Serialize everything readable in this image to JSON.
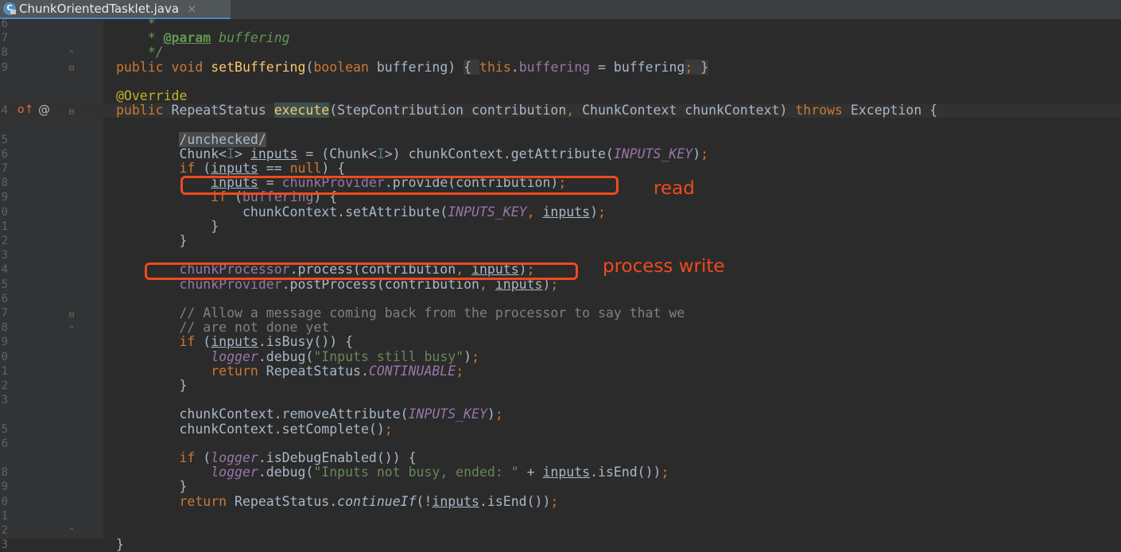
{
  "tab": {
    "filename": "ChunkOrientedTasklet.java",
    "close": "×",
    "icon": "C"
  },
  "gutter": {
    "line_numbers": [
      "6",
      "7",
      "8",
      "9",
      "",
      "",
      "4",
      "",
      "5",
      "6",
      "7",
      "8",
      "9",
      "0",
      "1",
      "2",
      "3",
      "4",
      "5",
      "6",
      "7",
      "8",
      "9",
      "0",
      "1",
      "2",
      "3",
      "",
      "5",
      "6",
      "",
      "8",
      "9",
      "0",
      "1",
      "2",
      "3"
    ],
    "override_icon": "o↑",
    "at_icon": "@"
  },
  "lines": [
    {
      "ln": "6",
      "segs": [
        {
          "t": "    *",
          "c": "doc"
        }
      ]
    },
    {
      "ln": "7",
      "segs": [
        {
          "t": "    * ",
          "c": "doc"
        },
        {
          "t": "@param",
          "c": "doctag"
        },
        {
          "t": " buffering",
          "c": "doc"
        }
      ]
    },
    {
      "ln": "8",
      "segs": [
        {
          "t": "    */",
          "c": "doc"
        }
      ]
    },
    {
      "ln": "9",
      "segs": [
        {
          "t": "public ",
          "c": "kw"
        },
        {
          "t": "void ",
          "c": "kw"
        },
        {
          "t": "setBuffering",
          "c": "mth"
        },
        {
          "t": "("
        },
        {
          "t": "boolean ",
          "c": "kw"
        },
        {
          "t": "buffering) "
        },
        {
          "t": "{ ",
          "c": "fold-bg"
        },
        {
          "t": "this",
          "c": "kw"
        },
        {
          "t": "."
        },
        {
          "t": "buffering",
          "c": "fld"
        },
        {
          "t": " = buffering"
        },
        {
          "t": "; ",
          "c": "kw fold-bg"
        },
        {
          "t": "}",
          "c": "fold-bg"
        }
      ]
    },
    {
      "ln": "",
      "segs": []
    },
    {
      "ln": "",
      "segs": [
        {
          "t": "@Override",
          "c": "ann"
        }
      ]
    },
    {
      "ln": "4",
      "segs": [
        {
          "t": "public ",
          "c": "kw"
        },
        {
          "t": "RepeatStatus "
        },
        {
          "t": "execute",
          "c": "mth hl"
        },
        {
          "t": "(StepContribution contribution"
        },
        {
          "t": ", ",
          "c": "kw"
        },
        {
          "t": "ChunkContext chunkContext) "
        },
        {
          "t": "throws ",
          "c": "kw"
        },
        {
          "t": "Exception {"
        }
      ]
    },
    {
      "ln": "",
      "segs": []
    },
    {
      "ln": "5",
      "segs": [
        {
          "t": "        "
        },
        {
          "t": "/unchecked/",
          "c": "unch"
        }
      ]
    },
    {
      "ln": "6",
      "segs": [
        {
          "t": "        Chunk<"
        },
        {
          "t": "I",
          "c": "tp"
        },
        {
          "t": "> "
        },
        {
          "t": "inputs",
          "c": "ul"
        },
        {
          "t": " = (Chunk<"
        },
        {
          "t": "I",
          "c": "tp"
        },
        {
          "t": ">) chunkContext.getAttribute("
        },
        {
          "t": "INPUTS_KEY",
          "c": "sfi"
        },
        {
          "t": ")"
        },
        {
          "t": ";",
          "c": "kw"
        }
      ]
    },
    {
      "ln": "7",
      "segs": [
        {
          "t": "        "
        },
        {
          "t": "if ",
          "c": "kw"
        },
        {
          "t": "("
        },
        {
          "t": "inputs",
          "c": "ul"
        },
        {
          "t": " == "
        },
        {
          "t": "null",
          "c": "kw"
        },
        {
          "t": ") {"
        }
      ]
    },
    {
      "ln": "8",
      "segs": [
        {
          "t": "            "
        },
        {
          "t": "inputs",
          "c": "ul"
        },
        {
          "t": " = "
        },
        {
          "t": "chunkProvider",
          "c": "fld"
        },
        {
          "t": ".provide(contribution)"
        },
        {
          "t": ";",
          "c": "kw"
        }
      ]
    },
    {
      "ln": "9",
      "segs": [
        {
          "t": "            "
        },
        {
          "t": "if ",
          "c": "kw"
        },
        {
          "t": "("
        },
        {
          "t": "buffering",
          "c": "fld"
        },
        {
          "t": ") {"
        }
      ]
    },
    {
      "ln": "0",
      "segs": [
        {
          "t": "                chunkContext.setAttribute("
        },
        {
          "t": "INPUTS_KEY",
          "c": "sfi"
        },
        {
          "t": ", ",
          "c": "kw"
        },
        {
          "t": "inputs",
          "c": "ul"
        },
        {
          "t": ")"
        },
        {
          "t": ";",
          "c": "kw"
        }
      ]
    },
    {
      "ln": "1",
      "segs": [
        {
          "t": "            }"
        }
      ]
    },
    {
      "ln": "2",
      "segs": [
        {
          "t": "        }"
        }
      ]
    },
    {
      "ln": "3",
      "segs": []
    },
    {
      "ln": "4",
      "segs": [
        {
          "t": "        "
        },
        {
          "t": "chunkProcessor",
          "c": "fld"
        },
        {
          "t": ".process(contribution"
        },
        {
          "t": ", ",
          "c": "kw"
        },
        {
          "t": "inputs",
          "c": "ul"
        },
        {
          "t": ")"
        },
        {
          "t": ";",
          "c": "kw"
        }
      ]
    },
    {
      "ln": "5",
      "segs": [
        {
          "t": "        "
        },
        {
          "t": "chunkProvider",
          "c": "fld"
        },
        {
          "t": ".postProcess(contribution"
        },
        {
          "t": ", ",
          "c": "kw"
        },
        {
          "t": "inputs",
          "c": "ul"
        },
        {
          "t": ")"
        },
        {
          "t": ";",
          "c": "kw"
        }
      ]
    },
    {
      "ln": "6",
      "segs": []
    },
    {
      "ln": "7",
      "segs": [
        {
          "t": "        // Allow a message coming back from the processor to say that we",
          "c": "cm"
        }
      ]
    },
    {
      "ln": "8",
      "segs": [
        {
          "t": "        // are not done yet",
          "c": "cm"
        }
      ]
    },
    {
      "ln": "9",
      "segs": [
        {
          "t": "        "
        },
        {
          "t": "if ",
          "c": "kw"
        },
        {
          "t": "("
        },
        {
          "t": "inputs",
          "c": "ul"
        },
        {
          "t": ".isBusy()) {"
        }
      ]
    },
    {
      "ln": "0",
      "segs": [
        {
          "t": "            "
        },
        {
          "t": "logger",
          "c": "sfi"
        },
        {
          "t": ".debug("
        },
        {
          "t": "\"Inputs still busy\"",
          "c": "str"
        },
        {
          "t": ")"
        },
        {
          "t": ";",
          "c": "kw"
        }
      ]
    },
    {
      "ln": "1",
      "segs": [
        {
          "t": "            "
        },
        {
          "t": "return ",
          "c": "kw"
        },
        {
          "t": "RepeatStatus."
        },
        {
          "t": "CONTINUABLE",
          "c": "sfi"
        },
        {
          "t": ";",
          "c": "kw"
        }
      ]
    },
    {
      "ln": "2",
      "segs": [
        {
          "t": "        }"
        }
      ]
    },
    {
      "ln": "3",
      "segs": []
    },
    {
      "ln": "",
      "segs": [
        {
          "t": "        chunkContext.removeAttribute("
        },
        {
          "t": "INPUTS_KEY",
          "c": "sfi"
        },
        {
          "t": ")"
        },
        {
          "t": ";",
          "c": "kw"
        }
      ]
    },
    {
      "ln": "5",
      "segs": [
        {
          "t": "        chunkContext.setComplete()"
        },
        {
          "t": ";",
          "c": "kw"
        }
      ]
    },
    {
      "ln": "6",
      "segs": []
    },
    {
      "ln": "",
      "segs": [
        {
          "t": "        "
        },
        {
          "t": "if ",
          "c": "kw"
        },
        {
          "t": "("
        },
        {
          "t": "logger",
          "c": "sfi"
        },
        {
          "t": ".isDebugEnabled()) {"
        }
      ]
    },
    {
      "ln": "8",
      "segs": [
        {
          "t": "            "
        },
        {
          "t": "logger",
          "c": "sfi"
        },
        {
          "t": ".debug("
        },
        {
          "t": "\"Inputs not busy, ended: \" ",
          "c": "str"
        },
        {
          "t": "+ "
        },
        {
          "t": "inputs",
          "c": "ul"
        },
        {
          "t": ".isEnd())"
        },
        {
          "t": ";",
          "c": "kw"
        }
      ]
    },
    {
      "ln": "9",
      "segs": [
        {
          "t": "        }"
        }
      ]
    },
    {
      "ln": "0",
      "segs": [
        {
          "t": "        "
        },
        {
          "t": "return ",
          "c": "kw"
        },
        {
          "t": "RepeatStatus."
        },
        {
          "t": "continueIf",
          "c": "it"
        },
        {
          "t": "(!"
        },
        {
          "t": "inputs",
          "c": "ul"
        },
        {
          "t": ".isEnd())"
        },
        {
          "t": ";",
          "c": "kw"
        }
      ]
    },
    {
      "ln": "1",
      "segs": []
    },
    {
      "ln": "2",
      "segs": []
    },
    {
      "ln": "3",
      "segs": [
        {
          "t": "}"
        }
      ]
    }
  ],
  "annotations": {
    "read": "read",
    "process_write": "process write"
  },
  "colors": {
    "highlight_box": "#f04a1d",
    "background": "#2b2b2b"
  }
}
